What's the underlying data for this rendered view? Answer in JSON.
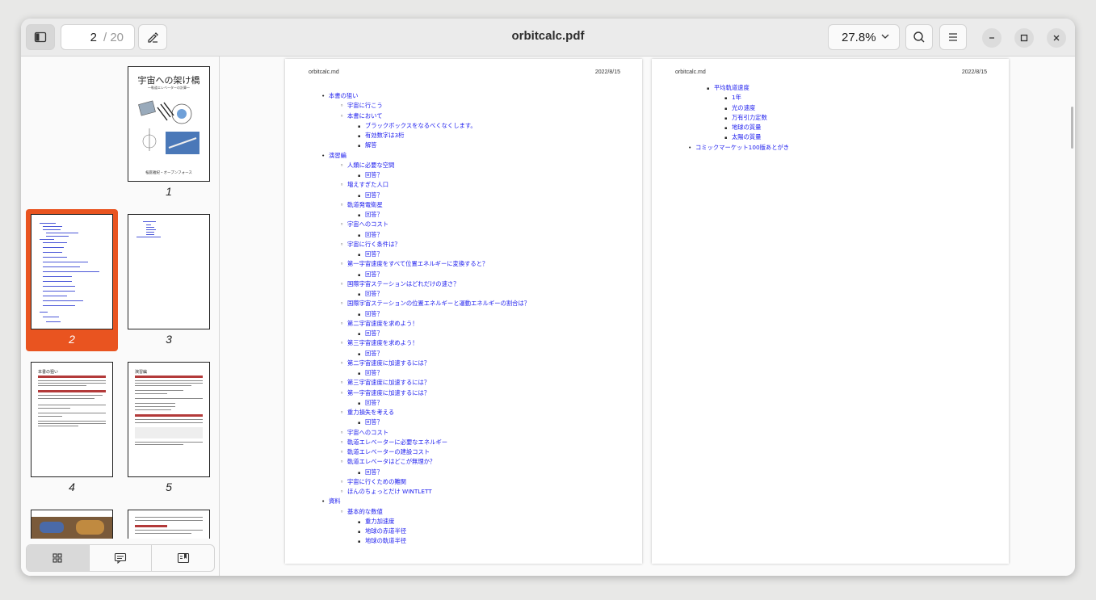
{
  "window": {
    "title": "orbitcalc.pdf"
  },
  "toolbar": {
    "current_page": "2",
    "total_pages": "/ 20",
    "zoom": "27.8%"
  },
  "thumbnails": [
    {
      "num": "1",
      "title": "宇宙への架け橋",
      "subtitle": "～軌道エレベーターの計算～",
      "footer": "桜庭雅紀・オープンフォース"
    },
    {
      "num": "2"
    },
    {
      "num": "3"
    },
    {
      "num": "4",
      "heading": "本書の狙い"
    },
    {
      "num": "5",
      "heading": "演習編"
    }
  ],
  "pages": {
    "left_header": "orbitcalc.md",
    "left_date": "2022/8/15",
    "right_header": "orbitcalc.md",
    "right_date": "2022/8/15"
  },
  "toc_left": [
    {
      "level": 1,
      "text": "本書の狙い"
    },
    {
      "level": 2,
      "text": "宇宙に行こう"
    },
    {
      "level": 2,
      "text": "本書において"
    },
    {
      "level": 3,
      "text": "ブラックボックスをなるべくなくします。"
    },
    {
      "level": 3,
      "text": "有効数字は3桁"
    },
    {
      "level": 3,
      "text": "解答"
    },
    {
      "level": 1,
      "text": "演習編"
    },
    {
      "level": 2,
      "text": "人類に必要な空間"
    },
    {
      "level": 3,
      "text": "回答？"
    },
    {
      "level": 2,
      "text": "増えすぎた人口"
    },
    {
      "level": 3,
      "text": "回答？"
    },
    {
      "level": 2,
      "text": "軌道発電衛星"
    },
    {
      "level": 3,
      "text": "回答？"
    },
    {
      "level": 2,
      "text": "宇宙へのコスト"
    },
    {
      "level": 3,
      "text": "回答？"
    },
    {
      "level": 2,
      "text": "宇宙に行く条件は？"
    },
    {
      "level": 3,
      "text": "回答？"
    },
    {
      "level": 2,
      "text": "第一宇宙速度をすべて位置エネルギーに変換すると？"
    },
    {
      "level": 3,
      "text": "回答？"
    },
    {
      "level": 2,
      "text": "国際宇宙ステーションはどれだけの速さ？"
    },
    {
      "level": 3,
      "text": "回答？"
    },
    {
      "level": 2,
      "text": "国際宇宙ステーションの位置エネルギーと運動エネルギーの割合は？"
    },
    {
      "level": 3,
      "text": "回答？"
    },
    {
      "level": 2,
      "text": "第二宇宙速度を求めよう！"
    },
    {
      "level": 3,
      "text": "回答？"
    },
    {
      "level": 2,
      "text": "第三宇宙速度を求めよう！"
    },
    {
      "level": 3,
      "text": "回答？"
    },
    {
      "level": 2,
      "text": "第二宇宙速度に加速するには？"
    },
    {
      "level": 3,
      "text": "回答？"
    },
    {
      "level": 2,
      "text": "第三宇宙速度に加速するには？"
    },
    {
      "level": 2,
      "text": "第一宇宙速度に加速するには？"
    },
    {
      "level": 3,
      "text": "回答？"
    },
    {
      "level": 2,
      "text": "重力損失を考える"
    },
    {
      "level": 3,
      "text": "回答？"
    },
    {
      "level": 2,
      "text": "宇宙へのコスト"
    },
    {
      "level": 2,
      "text": "軌道エレベーターに必要なエネルギー"
    },
    {
      "level": 2,
      "text": "軌道エレベーターの建設コスト"
    },
    {
      "level": 2,
      "text": "軌道エレベータはどこが無理か？"
    },
    {
      "level": 3,
      "text": "回答？"
    },
    {
      "level": 2,
      "text": "宇宙に行くための難関"
    },
    {
      "level": 2,
      "text": "ほんのちょっとだけ WINTLETT"
    },
    {
      "level": 1,
      "text": "資料"
    },
    {
      "level": 2,
      "text": "基本的な数値"
    },
    {
      "level": 3,
      "text": "重力加速度"
    },
    {
      "level": 3,
      "text": "地球の赤道半径"
    },
    {
      "level": 3,
      "text": "地球の軌道半径"
    }
  ],
  "toc_right": [
    {
      "level": 3,
      "text": "平均軌道速度"
    },
    {
      "level": 4,
      "text": "1年"
    },
    {
      "level": 4,
      "text": "光の速度"
    },
    {
      "level": 4,
      "text": "万有引力定数"
    },
    {
      "level": 4,
      "text": "地球の質量"
    },
    {
      "level": 4,
      "text": "太陽の質量"
    },
    {
      "level": 1,
      "text": "コミックマーケット100版あとがき"
    }
  ],
  "colors": {
    "accent": "#e95420",
    "link": "#1a1aee"
  },
  "icons": [
    "sidebar-toggle-icon",
    "annotate-icon",
    "search-icon",
    "menu-icon",
    "minimize-icon",
    "maximize-icon",
    "close-icon",
    "thumbnails-icon",
    "annotations-icon",
    "bookmarks-icon"
  ]
}
